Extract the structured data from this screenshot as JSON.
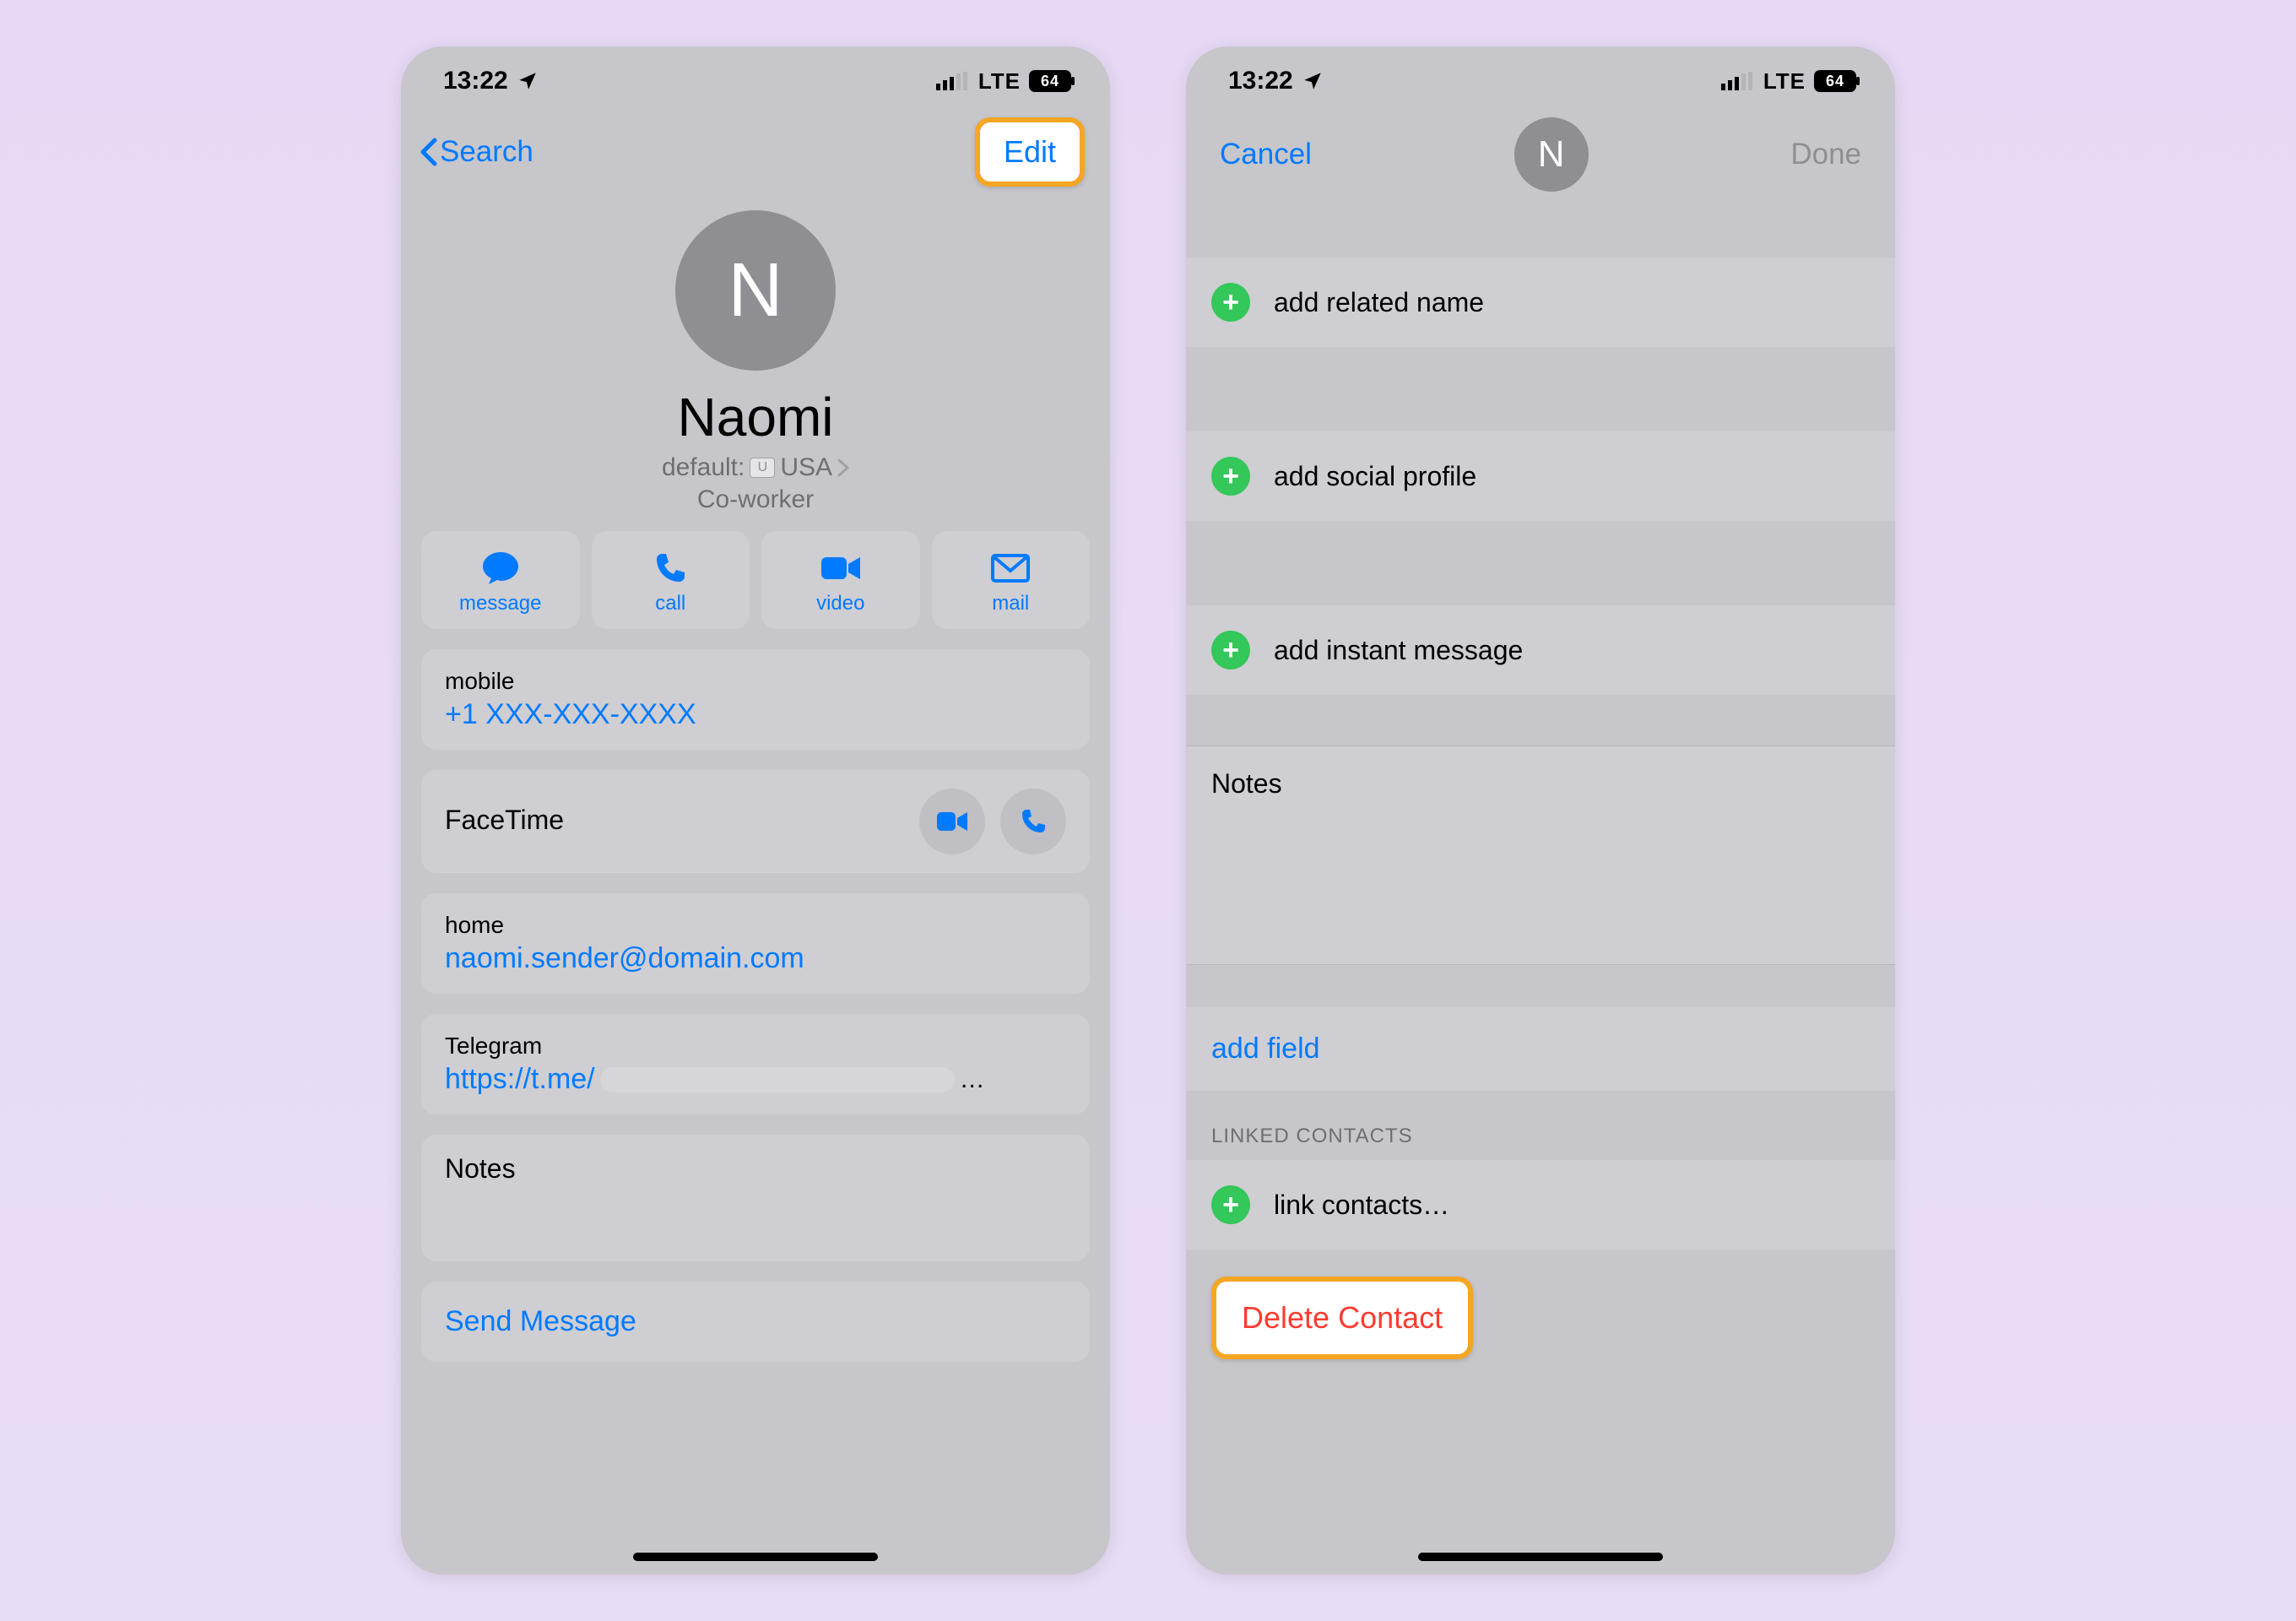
{
  "status": {
    "time": "13:22",
    "network": "LTE",
    "battery": "64"
  },
  "left": {
    "back": "Search",
    "edit": "Edit",
    "avatar_initial": "N",
    "name": "Naomi",
    "default_label": "default:",
    "country": "USA",
    "role": "Co-worker",
    "actions": {
      "message": "message",
      "call": "call",
      "video": "video",
      "mail": "mail"
    },
    "phone": {
      "label": "mobile",
      "value": "+1 XXX-XXX-XXXX"
    },
    "facetime": "FaceTime",
    "email": {
      "label": "home",
      "value": "naomi.sender@domain.com"
    },
    "telegram": {
      "label": "Telegram",
      "value": "https://t.me/",
      "ellipsis": "…"
    },
    "notes": "Notes",
    "send_message": "Send Message"
  },
  "right": {
    "cancel": "Cancel",
    "done": "Done",
    "avatar_initial": "N",
    "add_related": "add related name",
    "add_social": "add social profile",
    "add_im": "add instant message",
    "notes": "Notes",
    "add_field": "add field",
    "linked_header": "LINKED CONTACTS",
    "link_contacts": "link contacts…",
    "delete": "Delete Contact"
  }
}
